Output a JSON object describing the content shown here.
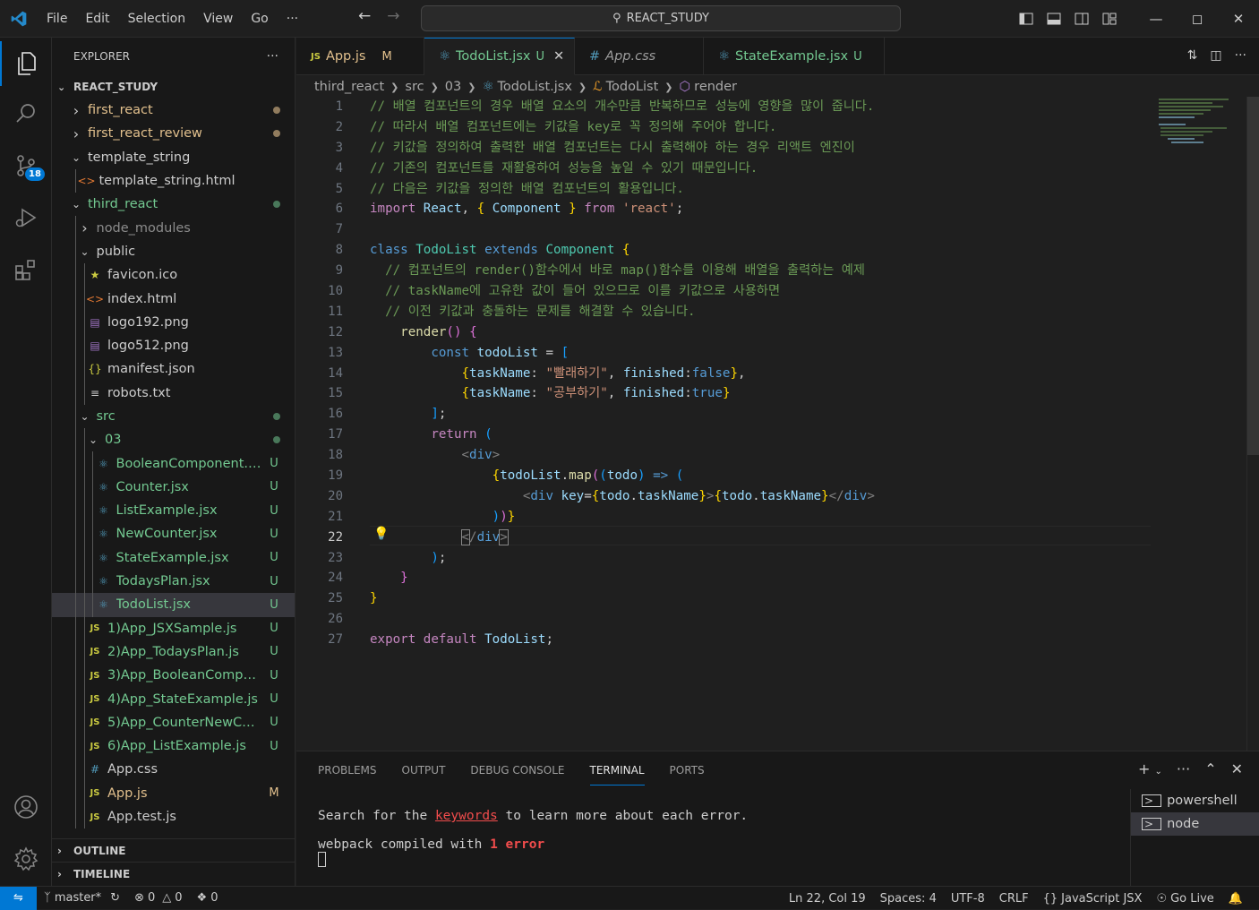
{
  "titlebar": {
    "menu": [
      "File",
      "Edit",
      "Selection",
      "View",
      "Go",
      "···"
    ],
    "search": "REACT_STUDY"
  },
  "explorer": {
    "header": "EXPLORER",
    "more": "···",
    "root": "REACT_STUDY",
    "items": [
      {
        "name": "first_react",
        "depth": 0,
        "type": "folder",
        "open": false,
        "color": "y",
        "mark": "dot-m"
      },
      {
        "name": "first_react_review",
        "depth": 0,
        "type": "folder",
        "open": false,
        "color": "y",
        "mark": "dot-m"
      },
      {
        "name": "template_string",
        "depth": 0,
        "type": "folder",
        "open": true,
        "color": "w",
        "mark": ""
      },
      {
        "name": "template_string.html",
        "depth": 1,
        "type": "html",
        "color": "w",
        "mark": ""
      },
      {
        "name": "third_react",
        "depth": 0,
        "type": "folder",
        "open": true,
        "color": "g",
        "mark": "dot"
      },
      {
        "name": "node_modules",
        "depth": 1,
        "type": "folder",
        "open": false,
        "color": "dim",
        "mark": ""
      },
      {
        "name": "public",
        "depth": 1,
        "type": "folder",
        "open": true,
        "color": "w",
        "mark": ""
      },
      {
        "name": "favicon.ico",
        "depth": 2,
        "type": "star",
        "color": "w",
        "mark": ""
      },
      {
        "name": "index.html",
        "depth": 2,
        "type": "html",
        "color": "w",
        "mark": ""
      },
      {
        "name": "logo192.png",
        "depth": 2,
        "type": "img",
        "color": "w",
        "mark": ""
      },
      {
        "name": "logo512.png",
        "depth": 2,
        "type": "img",
        "color": "w",
        "mark": ""
      },
      {
        "name": "manifest.json",
        "depth": 2,
        "type": "json",
        "color": "w",
        "mark": ""
      },
      {
        "name": "robots.txt",
        "depth": 2,
        "type": "txt",
        "color": "w",
        "mark": ""
      },
      {
        "name": "src",
        "depth": 1,
        "type": "folder",
        "open": true,
        "color": "g",
        "mark": "dot"
      },
      {
        "name": "03",
        "depth": 2,
        "type": "folder",
        "open": true,
        "color": "g",
        "mark": "dot"
      },
      {
        "name": "BooleanComponent.jsx",
        "depth": 3,
        "type": "react",
        "color": "g",
        "mark": "U"
      },
      {
        "name": "Counter.jsx",
        "depth": 3,
        "type": "react",
        "color": "g",
        "mark": "U"
      },
      {
        "name": "ListExample.jsx",
        "depth": 3,
        "type": "react",
        "color": "g",
        "mark": "U"
      },
      {
        "name": "NewCounter.jsx",
        "depth": 3,
        "type": "react",
        "color": "g",
        "mark": "U"
      },
      {
        "name": "StateExample.jsx",
        "depth": 3,
        "type": "react",
        "color": "g",
        "mark": "U"
      },
      {
        "name": "TodaysPlan.jsx",
        "depth": 3,
        "type": "react",
        "color": "g",
        "mark": "U"
      },
      {
        "name": "TodoList.jsx",
        "depth": 3,
        "type": "react",
        "color": "g",
        "mark": "U",
        "selected": true
      },
      {
        "name": "1)App_JSXSample.js",
        "depth": 2,
        "type": "js",
        "color": "g",
        "mark": "U"
      },
      {
        "name": "2)App_TodaysPlan.js",
        "depth": 2,
        "type": "js",
        "color": "g",
        "mark": "U"
      },
      {
        "name": "3)App_BooleanCompon...",
        "depth": 2,
        "type": "js",
        "color": "g",
        "mark": "U"
      },
      {
        "name": "4)App_StateExample.js",
        "depth": 2,
        "type": "js",
        "color": "g",
        "mark": "U"
      },
      {
        "name": "5)App_CounterNewCou...",
        "depth": 2,
        "type": "js",
        "color": "g",
        "mark": "U"
      },
      {
        "name": "6)App_ListExample.js",
        "depth": 2,
        "type": "js",
        "color": "g",
        "mark": "U"
      },
      {
        "name": "App.css",
        "depth": 2,
        "type": "css",
        "color": "w",
        "mark": ""
      },
      {
        "name": "App.js",
        "depth": 2,
        "type": "js",
        "color": "y",
        "mark": "M"
      },
      {
        "name": "App.test.js",
        "depth": 2,
        "type": "js",
        "color": "w",
        "mark": ""
      }
    ],
    "outline": "OUTLINE",
    "timeline": "TIMELINE"
  },
  "activity": {
    "scm_badge": "18"
  },
  "tabs": [
    {
      "icon": "JS",
      "label": "App.js",
      "status": "M",
      "color": "#e2c08d"
    },
    {
      "icon": "⚛",
      "label": "TodoList.jsx",
      "status": "U",
      "color": "#73c991",
      "active": true,
      "close": "✕"
    },
    {
      "icon": "#",
      "label": "App.css",
      "status": "",
      "color": "#9d9d9d"
    },
    {
      "icon": "⚛",
      "label": "StateExample.jsx",
      "status": "U",
      "color": "#73c991"
    }
  ],
  "breadcrumbs": [
    "third_react",
    "src",
    "03",
    "TodoList.jsx",
    "TodoList",
    "render"
  ],
  "editor": {
    "current_line": 22,
    "line_count": 27
  },
  "panel": {
    "tabs": [
      "PROBLEMS",
      "OUTPUT",
      "DEBUG CONSOLE",
      "TERMINAL",
      "PORTS"
    ],
    "active_tab": "TERMINAL",
    "line1_a": "Search for the ",
    "line1_link": "keywords",
    "line1_b": " to learn more about each error.",
    "line2_a": "webpack compiled with ",
    "line2_num": "1",
    "line2_err": "error",
    "terminals": [
      "powershell",
      "node"
    ]
  },
  "status": {
    "branch": "master*",
    "errors": "0",
    "warnings": "0",
    "ports": "0",
    "position": "Ln 22, Col 19",
    "spaces": "Spaces: 4",
    "encoding": "UTF-8",
    "eol": "CRLF",
    "language": "JavaScript JSX",
    "golive": "Go Live"
  }
}
